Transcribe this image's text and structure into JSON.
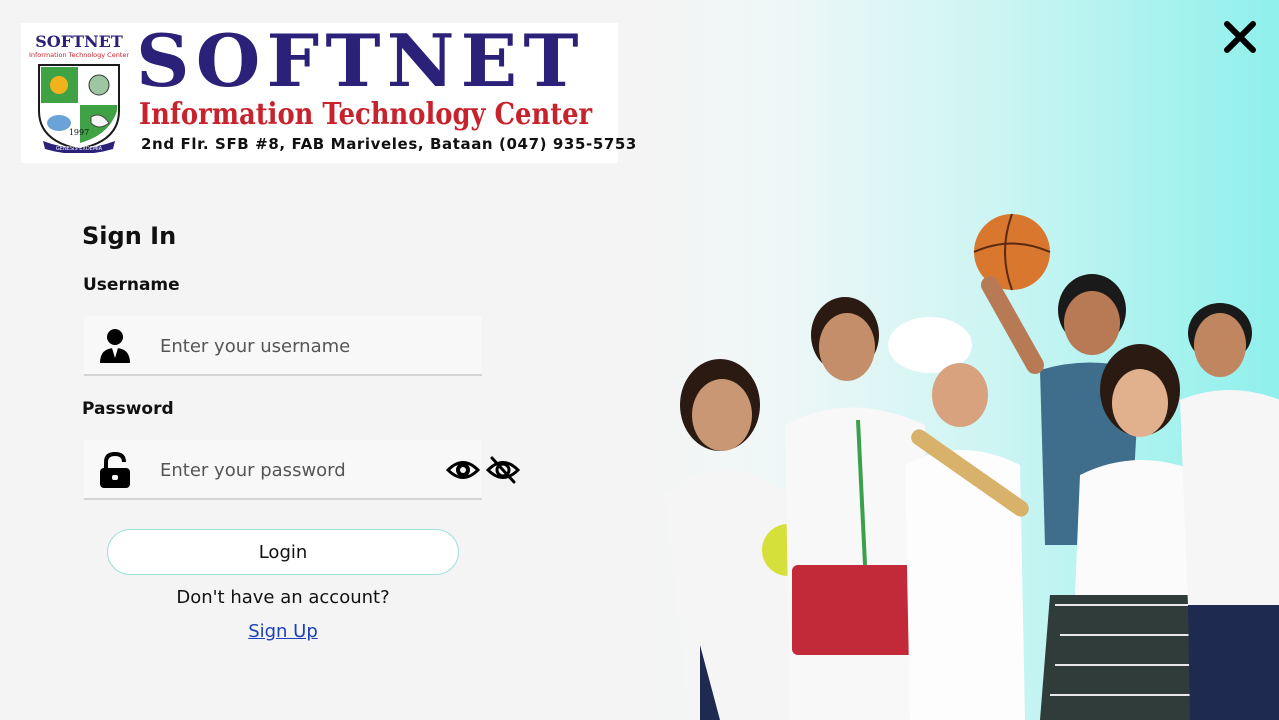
{
  "logo": {
    "name": "SOFTNET",
    "subtitle": "Information Technology Center",
    "address": "2nd Flr. SFB #8, FAB Mariveles, Bataan (047) 935-5753",
    "seal_text_top": "SOFTNET",
    "seal_text_sub": "Information Technology Center",
    "seal_year": "1997",
    "seal_motto": "GENESIS EXDEMIA"
  },
  "form": {
    "title": "Sign In",
    "username_label": "Username",
    "username_placeholder": "Enter your username",
    "username_value": "",
    "password_label": "Password",
    "password_placeholder": "Enter your password",
    "password_value": "",
    "login_label": "Login",
    "no_account_text": "Don't have an account?",
    "signup_label": "Sign Up"
  },
  "icons": {
    "close": "close-icon",
    "user": "user-icon",
    "lock": "unlock-icon",
    "show_password": "eye-icon",
    "hide_password": "eye-slash-icon"
  },
  "colors": {
    "brand_blue": "#2b2178",
    "brand_red": "#c8232c",
    "accent_cyan": "#8ff0ec",
    "link": "#1c3fb8"
  }
}
